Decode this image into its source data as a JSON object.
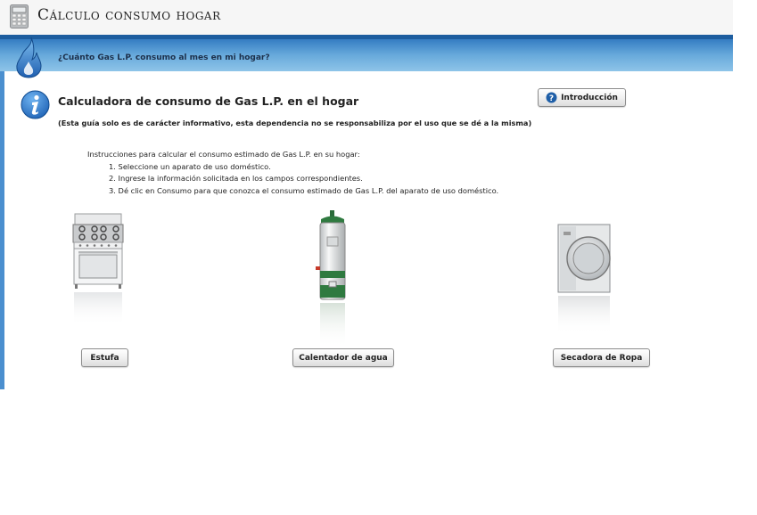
{
  "app": {
    "title": "Cálculo consumo hogar",
    "icon": "calculator-icon"
  },
  "banner": {
    "question": "¿Cuánto Gas L.P. consumo al mes en mi hogar?",
    "icon": "flame-icon",
    "colors": {
      "top": "#2d6fb5",
      "bottom": "#8ec4e8"
    }
  },
  "header": {
    "icon": "info-icon",
    "title": "Calculadora de consumo de Gas L.P. en el hogar",
    "disclaimer": "(Esta guía solo es de carácter informativo, esta dependencia no se responsabiliza por el uso que se dé a la misma)",
    "intro_button": "Introducción"
  },
  "instructions": {
    "heading": "Instrucciones para calcular el consumo estimado de Gas L.P. en su hogar:",
    "steps": [
      "1. Seleccione un aparato de uso doméstico.",
      "2. Ingrese la información solicitada en los campos correspondientes.",
      "3. Dé clic en Consumo para que conozca el consumo estimado de Gas L.P. del aparato de uso doméstico."
    ]
  },
  "appliances": [
    {
      "label": "Estufa",
      "icon": "stove-icon"
    },
    {
      "label": "Calentador de agua",
      "icon": "water-heater-icon"
    },
    {
      "label": "Secadora de Ropa",
      "icon": "clothes-dryer-icon"
    }
  ]
}
